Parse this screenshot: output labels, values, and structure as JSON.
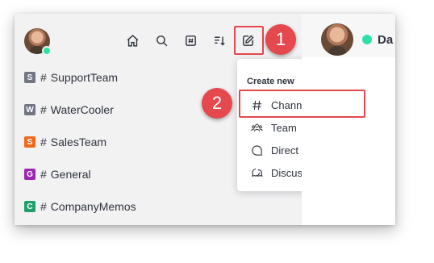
{
  "toolbar": {
    "icons": [
      "home-icon",
      "search-icon",
      "directory-icon",
      "sort-icon",
      "create-new-icon"
    ]
  },
  "rooms": [
    {
      "initial": "S",
      "color": "#717680",
      "name": "SupportTeam"
    },
    {
      "initial": "W",
      "color": "#717680",
      "name": "WaterCooler"
    },
    {
      "initial": "S",
      "color": "#f06a1d",
      "name": "SalesTeam"
    },
    {
      "initial": "G",
      "color": "#9c27b0",
      "name": "General"
    },
    {
      "initial": "C",
      "color": "#22a06b",
      "name": "CompanyMemos"
    }
  ],
  "create_menu": {
    "title": "Create new",
    "items": [
      {
        "label": "Channel",
        "icon": "hash-icon"
      },
      {
        "label": "Team",
        "icon": "team-icon"
      },
      {
        "label": "Direct Messages",
        "icon": "direct-message-icon"
      },
      {
        "label": "Discussion",
        "icon": "discussion-icon"
      }
    ]
  },
  "steps": {
    "one": "1",
    "two": "2"
  },
  "header": {
    "user_name_partial": "Da"
  },
  "colors": {
    "accent": "#e5484d",
    "online": "#2de0a5"
  }
}
